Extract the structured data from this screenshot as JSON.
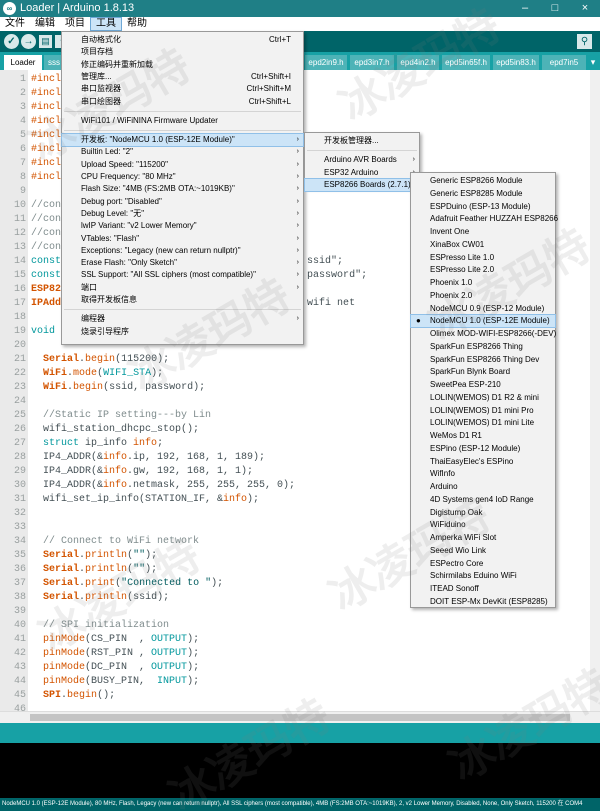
{
  "window": {
    "title": "Loader | Arduino 1.8.13",
    "icon": "arduino-logo-icon",
    "controls": [
      "–",
      "□",
      "×"
    ]
  },
  "menubar": [
    "文件",
    "编辑",
    "项目",
    "工具",
    "帮助"
  ],
  "toolbar": {
    "verify": "✓",
    "upload": "→",
    "new": "▤",
    "open": "↑",
    "save": "↓",
    "serial": "⚲"
  },
  "tabs": [
    "Loader",
    "sss",
    "epd2in9.h",
    "epd3in7.h",
    "epd4in2.h",
    "epd5in65f.h",
    "epd5in83.h",
    "epd7in5"
  ],
  "tab_overflow": "▾",
  "lines": [
    {
      "n": "1",
      "code": "#include <...>"
    },
    {
      "n": "2",
      "code": "#include <...>"
    },
    {
      "n": "3",
      "code": "#include <...>"
    },
    {
      "n": "4",
      "code": "#include <...>"
    },
    {
      "n": "5",
      "code": "#include <...>"
    },
    {
      "n": "6",
      "code": "#include <...>"
    },
    {
      "n": "7",
      "code": "#include <...>"
    },
    {
      "n": "8",
      "code": "#include <...>"
    },
    {
      "n": "9",
      "code": ""
    },
    {
      "n": "10",
      "code": "//con"
    },
    {
      "n": "11",
      "code": "//con"
    },
    {
      "n": "12",
      "code": "//con"
    },
    {
      "n": "13",
      "code": "//con"
    },
    {
      "n": "14",
      "code": "const                                      ur ssid\";"
    },
    {
      "n": "15",
      "code": "const                                      ur password\";"
    },
    {
      "n": "16",
      "code": "ESP82"
    },
    {
      "n": "17",
      "code": "IPAdd                                      al wifi net"
    },
    {
      "n": "18",
      "code": ""
    },
    {
      "n": "19",
      "code": "void"
    },
    {
      "n": "20",
      "code": ""
    },
    {
      "n": "21",
      "code": "  Serial.begin(115200);"
    },
    {
      "n": "22",
      "code": "  WiFi.mode(WIFI_STA);"
    },
    {
      "n": "23",
      "code": "  WiFi.begin(ssid, password);"
    },
    {
      "n": "24",
      "code": ""
    },
    {
      "n": "25",
      "code": "  //Static IP setting---by Lin"
    },
    {
      "n": "26",
      "code": "  wifi_station_dhcpc_stop();"
    },
    {
      "n": "27",
      "code": "  struct ip_info info;"
    },
    {
      "n": "28",
      "code": "  IP4_ADDR(&info.ip, 192, 168, 1, 189);"
    },
    {
      "n": "29",
      "code": "  IP4_ADDR(&info.gw, 192, 168, 1, 1);"
    },
    {
      "n": "30",
      "code": "  IP4_ADDR(&info.netmask, 255, 255, 255, 0);"
    },
    {
      "n": "31",
      "code": "  wifi_set_ip_info(STATION_IF, &info);"
    },
    {
      "n": "32",
      "code": ""
    },
    {
      "n": "33",
      "code": ""
    },
    {
      "n": "34",
      "code": "  // Connect to WiFi network"
    },
    {
      "n": "35",
      "code": "  Serial.println(\"\");"
    },
    {
      "n": "36",
      "code": "  Serial.println(\"\");"
    },
    {
      "n": "37",
      "code": "  Serial.print(\"Connected to \");"
    },
    {
      "n": "38",
      "code": "  Serial.println(ssid);"
    },
    {
      "n": "39",
      "code": ""
    },
    {
      "n": "40",
      "code": "  // SPI initialization"
    },
    {
      "n": "41",
      "code": "  pinMode(CS_PIN  , OUTPUT);"
    },
    {
      "n": "42",
      "code": "  pinMode(RST_PIN , OUTPUT);"
    },
    {
      "n": "43",
      "code": "  pinMode(DC_PIN  , OUTPUT);"
    },
    {
      "n": "44",
      "code": "  pinMode(BUSY_PIN,  INPUT);"
    },
    {
      "n": "45",
      "code": "  SPI.begin();"
    },
    {
      "n": "46",
      "code": ""
    }
  ],
  "tools_menu": [
    {
      "label": "自动格式化",
      "shortcut": "Ctrl+T"
    },
    {
      "label": "项目存档",
      "shortcut": ""
    },
    {
      "label": "修正编码并重新加载",
      "shortcut": ""
    },
    {
      "label": "管理库...",
      "shortcut": "Ctrl+Shift+I"
    },
    {
      "label": "串口监视器",
      "shortcut": "Ctrl+Shift+M"
    },
    {
      "label": "串口绘图器",
      "shortcut": "Ctrl+Shift+L"
    },
    {
      "sep": true
    },
    {
      "label": "WiFi101 / WiFiNINA Firmware Updater",
      "shortcut": ""
    },
    {
      "sep": true
    },
    {
      "label": "开发板: \"NodeMCU 1.0 (ESP-12E Module)\"",
      "submenu": true,
      "highlight": true
    },
    {
      "label": "Builtin Led: \"2\"",
      "submenu": true
    },
    {
      "label": "Upload Speed: \"115200\"",
      "submenu": true
    },
    {
      "label": "CPU Frequency: \"80 MHz\"",
      "submenu": true
    },
    {
      "label": "Flash Size: \"4MB (FS:2MB OTA:~1019KB)\"",
      "submenu": true
    },
    {
      "label": "Debug port: \"Disabled\"",
      "submenu": true
    },
    {
      "label": "Debug Level: \"无\"",
      "submenu": true
    },
    {
      "label": "lwIP Variant: \"v2 Lower Memory\"",
      "submenu": true
    },
    {
      "label": "VTables: \"Flash\"",
      "submenu": true
    },
    {
      "label": "Exceptions: \"Legacy (new can return nullptr)\"",
      "submenu": true
    },
    {
      "label": "Erase Flash: \"Only Sketch\"",
      "submenu": true
    },
    {
      "label": "SSL Support: \"All SSL ciphers (most compatible)\"",
      "submenu": true
    },
    {
      "label": "端口",
      "submenu": true
    },
    {
      "label": "取得开发板信息",
      "shortcut": ""
    },
    {
      "sep": true
    },
    {
      "label": "编程器",
      "submenu": true
    },
    {
      "label": "烧录引导程序",
      "shortcut": ""
    }
  ],
  "board_menu": [
    {
      "label": "开发板管理器..."
    },
    {
      "sep": true
    },
    {
      "label": "Arduino AVR Boards",
      "submenu": true
    },
    {
      "label": "ESP32 Arduino",
      "submenu": true
    },
    {
      "label": "ESP8266 Boards (2.7.1)",
      "submenu": true,
      "highlight": true
    }
  ],
  "esp_boards": [
    "Generic ESP8266 Module",
    "Generic ESP8285 Module",
    "ESPDuino (ESP-13 Module)",
    "Adafruit Feather HUZZAH ESP8266",
    "Invent One",
    "XinaBox CW01",
    "ESPresso Lite 1.0",
    "ESPresso Lite 2.0",
    "Phoenix 1.0",
    "Phoenix 2.0",
    "NodeMCU 0.9 (ESP-12 Module)",
    "NodeMCU 1.0 (ESP-12E Module)",
    "Olimex MOD-WIFI-ESP8266(-DEV)",
    "SparkFun ESP8266 Thing",
    "SparkFun ESP8266 Thing Dev",
    "SparkFun Blynk Board",
    "SweetPea ESP-210",
    "LOLIN(WEMOS) D1 R2 & mini",
    "LOLIN(WEMOS) D1 mini Pro",
    "LOLIN(WEMOS) D1 mini Lite",
    "WeMos D1 R1",
    "ESPino (ESP-12 Module)",
    "ThaiEasyElec's ESPino",
    "WifInfo",
    "Arduino",
    "4D Systems gen4 IoD Range",
    "Digistump Oak",
    "WiFiduino",
    "Amperka WiFi Slot",
    "Seeed Wio Link",
    "ESPectro Core",
    "Schirmilabs Eduino WiFi",
    "ITEAD Sonoff",
    "DOIT ESP-Mx DevKit (ESP8285)"
  ],
  "esp_selected": "NodeMCU 1.0 (ESP-12E Module)",
  "status_bottom": "NodeMCU 1.0 (ESP-12E Module), 80 MHz, Flash, Legacy (new can return nullptr), All SSL ciphers (most compatible), 4MB (FS:2MB OTA:~1019KB), 2, v2 Lower Memory, Disabled, None, Only Sketch, 115200 在 COM4",
  "watermark": "冰凌玛特"
}
